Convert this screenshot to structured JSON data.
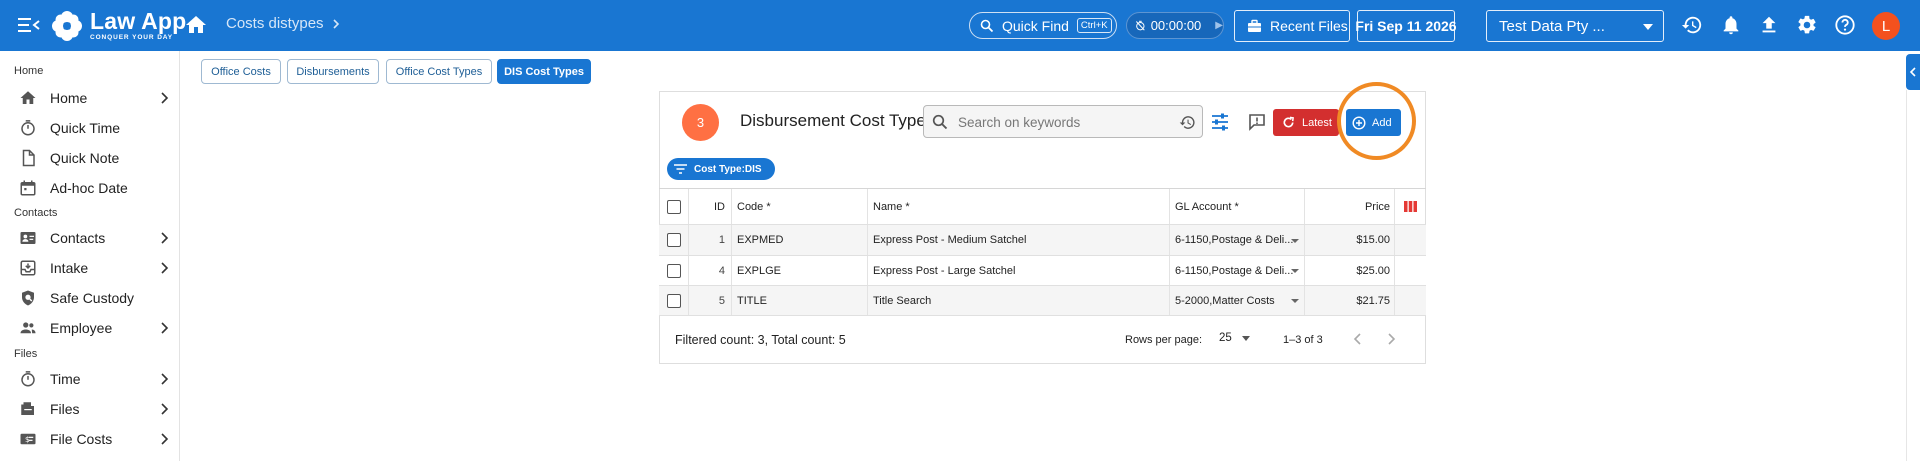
{
  "app": {
    "logo_title": "Law App",
    "logo_sub": "CONQUER YOUR DAY",
    "breadcrumb": "Costs distypes",
    "quick_find_label": "Quick Find",
    "quick_find_shortcut": "Ctrl+K",
    "timer": "00:00:00",
    "recent_files_label": "Recent Files",
    "date": "Fri Sep 11 2026",
    "company": "Test Data Pty ...",
    "avatar_letter": "L",
    "colors": {
      "primary": "#1976d2",
      "danger": "#d32f2f",
      "badge": "#ff7043",
      "avatar": "#f4511e",
      "highlight": "#f08a24"
    }
  },
  "sidebar": {
    "sections": [
      {
        "title": "Home",
        "items": [
          {
            "label": "Home",
            "icon": "home-icon",
            "has_children": true
          },
          {
            "label": "Quick Time",
            "icon": "stopwatch-icon",
            "has_children": false
          },
          {
            "label": "Quick Note",
            "icon": "document-icon",
            "has_children": false
          },
          {
            "label": "Ad-hoc Date",
            "icon": "calendar-icon",
            "has_children": false
          }
        ]
      },
      {
        "title": "Contacts",
        "items": [
          {
            "label": "Contacts",
            "icon": "contacts-icon",
            "has_children": true
          },
          {
            "label": "Intake",
            "icon": "intake-icon",
            "has_children": true
          },
          {
            "label": "Safe Custody",
            "icon": "safe-custody-icon",
            "has_children": false
          },
          {
            "label": "Employee",
            "icon": "employee-icon",
            "has_children": true
          }
        ]
      },
      {
        "title": "Files",
        "items": [
          {
            "label": "Time",
            "icon": "stopwatch-icon",
            "has_children": true
          },
          {
            "label": "Files",
            "icon": "files-icon",
            "has_children": true
          },
          {
            "label": "File Costs",
            "icon": "file-costs-icon",
            "has_children": true
          }
        ]
      }
    ]
  },
  "tabs": [
    {
      "label": "Office Costs",
      "active": false
    },
    {
      "label": "Disbursements",
      "active": false
    },
    {
      "label": "Office Cost Types",
      "active": false
    },
    {
      "label": "DIS Cost Types",
      "active": true
    }
  ],
  "panel": {
    "count": "3",
    "title": "Disbursement Cost Type",
    "search_placeholder": "Search on keywords",
    "latest_label": "Latest",
    "add_label": "Add",
    "filter_chip": "Cost Type:DIS"
  },
  "table": {
    "columns": {
      "id": "ID",
      "code": "Code *",
      "name": "Name *",
      "gl": "GL Account *",
      "price": "Price"
    },
    "rows": [
      {
        "id": "1",
        "code": "EXPMED",
        "name": "Express Post - Medium Satchel",
        "gl": "6-1150,Postage & Deli...",
        "price": "$15.00"
      },
      {
        "id": "4",
        "code": "EXPLGE",
        "name": "Express Post - Large Satchel",
        "gl": "6-1150,Postage & Deli...",
        "price": "$25.00"
      },
      {
        "id": "5",
        "code": "TITLE",
        "name": "Title Search",
        "gl": "5-2000,Matter Costs",
        "price": "$21.75"
      }
    ]
  },
  "footer": {
    "count_text": "Filtered count: 3, Total count: 5",
    "rows_per_page_label": "Rows per page:",
    "rows_per_page": "25",
    "range": "1–3 of 3"
  }
}
